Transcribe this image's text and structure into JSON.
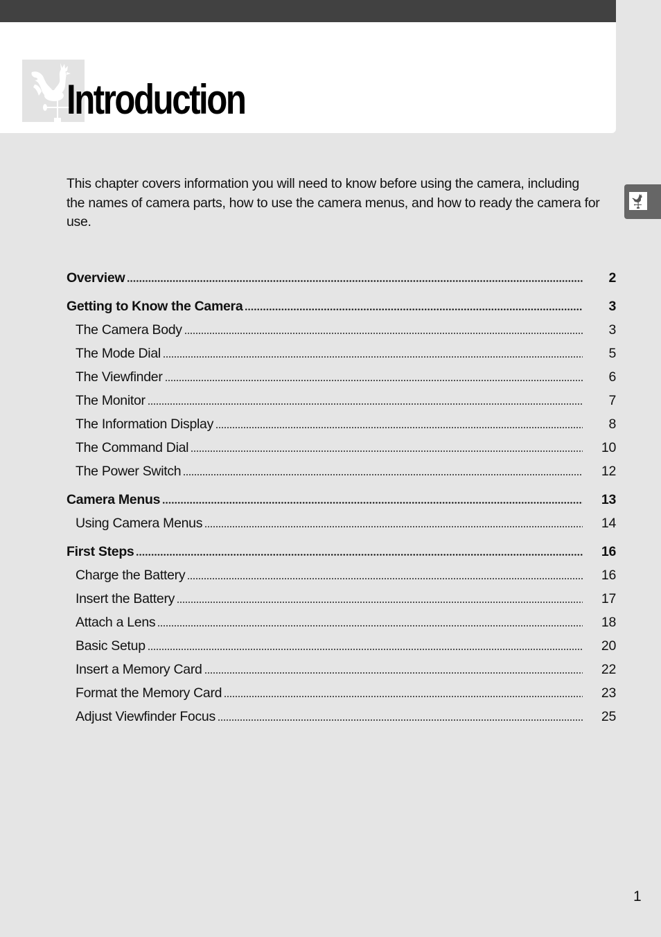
{
  "header": {
    "chapter_title": "Introduction",
    "chapter_icon": "weathervane-rooster-icon"
  },
  "side_tab": {
    "icon": "weathervane-rooster-icon"
  },
  "intro_text": "This chapter covers information you will need to know before using the camera, including the names of camera parts, how to use the camera menus, and how to ready the camera for use.",
  "toc": [
    {
      "level": 1,
      "title": "Overview",
      "page": "2"
    },
    {
      "level": 1,
      "title": "Getting to Know the Camera",
      "page": "3"
    },
    {
      "level": 2,
      "title": "The Camera Body",
      "page": "3"
    },
    {
      "level": 2,
      "title": "The Mode Dial",
      "page": "5"
    },
    {
      "level": 2,
      "title": "The Viewfinder",
      "page": "6"
    },
    {
      "level": 2,
      "title": "The Monitor",
      "page": "7"
    },
    {
      "level": 2,
      "title": "The Information Display",
      "page": "8"
    },
    {
      "level": 2,
      "title": "The Command Dial",
      "page": "10"
    },
    {
      "level": 2,
      "title": "The Power Switch",
      "page": "12"
    },
    {
      "level": 1,
      "title": "Camera Menus",
      "page": "13"
    },
    {
      "level": 2,
      "title": "Using Camera Menus",
      "page": "14"
    },
    {
      "level": 1,
      "title": "First Steps",
      "page": "16"
    },
    {
      "level": 2,
      "title": "Charge the Battery",
      "page": "16"
    },
    {
      "level": 2,
      "title": "Insert the Battery",
      "page": "17"
    },
    {
      "level": 2,
      "title": "Attach a Lens",
      "page": "18"
    },
    {
      "level": 2,
      "title": "Basic Setup",
      "page": "20"
    },
    {
      "level": 2,
      "title": "Insert a Memory Card",
      "page": "22"
    },
    {
      "level": 2,
      "title": "Format the Memory Card",
      "page": "23"
    },
    {
      "level": 2,
      "title": "Adjust Viewfinder Focus",
      "page": "25"
    }
  ],
  "footer": {
    "page_number": "1"
  },
  "colors": {
    "top_bar": "#414141",
    "header_panel": "#ffffff",
    "page_background": "#e5e5e5",
    "side_tab": "#666666"
  }
}
